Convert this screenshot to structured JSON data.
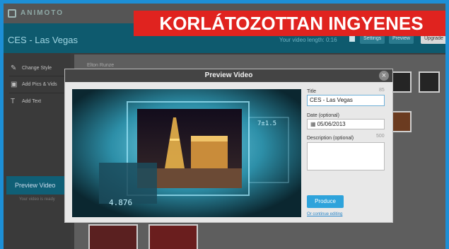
{
  "app": {
    "logo_text": "ANIMOTO"
  },
  "header": {
    "project_title": "CES - Las Vegas",
    "right_text": "Your video length: 0:16",
    "btn_settings": "Settings",
    "btn_preview": "Preview",
    "btn_upgrade": "Upgrade"
  },
  "headline": "KORLÁTOZOTTAN INGYENES",
  "sidebar": {
    "items": [
      {
        "label": "Change Style",
        "icon": "brush-icon"
      },
      {
        "label": "Add Pics & Vids",
        "icon": "photo-icon"
      },
      {
        "label": "Add Text",
        "icon": "text-icon"
      }
    ],
    "preview_label": "Preview Video",
    "sub_text": "Your video is ready"
  },
  "content": {
    "song_label": "Elton Runze"
  },
  "modal": {
    "title": "Preview Video",
    "close_symbol": "×",
    "video_overlay_text": "4.876",
    "video_overlay_text2": "7±1.5",
    "form": {
      "title_label": "Title",
      "title_count": "85",
      "title_value": "CES - Las Vegas",
      "date_label": "Date (optional)",
      "date_value": "05/06/2013",
      "desc_label": "Description (optional)",
      "desc_count": "500",
      "desc_value": "",
      "produce_label": "Produce",
      "continue_label": "Or continue editing"
    }
  },
  "colors": {
    "frame": "#1d8fd6",
    "headline_bg": "#e0231f",
    "teal_bar": "#0e5a6e",
    "produce_btn": "#2ea3db"
  }
}
